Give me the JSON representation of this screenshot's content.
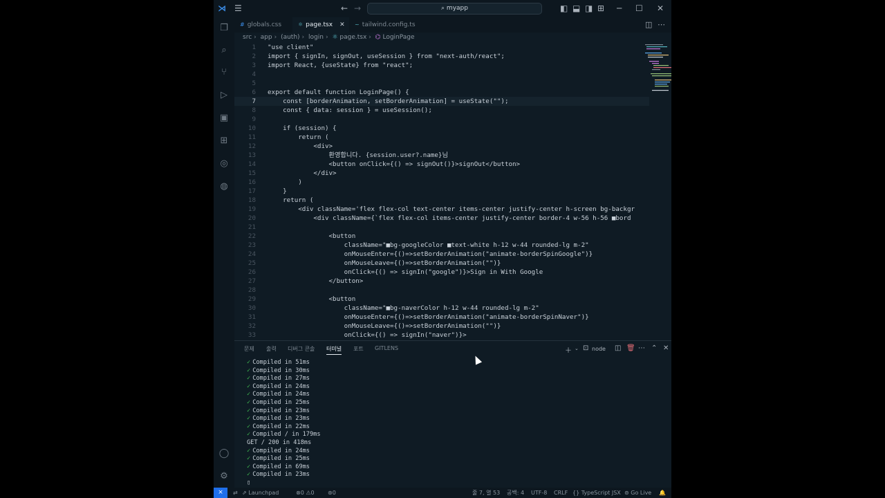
{
  "titlebar": {
    "search_text": "myapp"
  },
  "tabs": [
    {
      "label": "globals.css",
      "icon": "#"
    },
    {
      "label": "page.tsx",
      "icon": "⚛"
    },
    {
      "label": "tailwind.config.ts",
      "icon": "~"
    }
  ],
  "breadcrumb": [
    "src",
    "app",
    "(auth)",
    "login",
    "page.tsx",
    "LoginPage"
  ],
  "editor": {
    "lines": [
      {
        "n": "1",
        "t": "\"use client\""
      },
      {
        "n": "2",
        "t": "import { signIn, signOut, useSession } from \"next-auth/react\";"
      },
      {
        "n": "3",
        "t": "import React, {useState} from \"react\";"
      },
      {
        "n": "4",
        "t": ""
      },
      {
        "n": "5",
        "t": ""
      },
      {
        "n": "6",
        "t": "export default function LoginPage() {"
      },
      {
        "n": "7",
        "t": "    const [borderAnimation, setBorderAnimation] = useState(\"\");"
      },
      {
        "n": "8",
        "t": "    const { data: session } = useSession();"
      },
      {
        "n": "9",
        "t": ""
      },
      {
        "n": "10",
        "t": "    if (session) {"
      },
      {
        "n": "11",
        "t": "        return ("
      },
      {
        "n": "12",
        "t": "            <div>"
      },
      {
        "n": "13",
        "t": "                환영합니다. {session.user?.name}님"
      },
      {
        "n": "14",
        "t": "                <button onClick={() => signOut()}>signOut</button>"
      },
      {
        "n": "15",
        "t": "            </div>"
      },
      {
        "n": "16",
        "t": "        )"
      },
      {
        "n": "17",
        "t": "    }"
      },
      {
        "n": "18",
        "t": "    return ("
      },
      {
        "n": "19",
        "t": "        <div className='flex flex-col text-center items-center justify-center h-screen bg-backgr"
      },
      {
        "n": "20",
        "t": "            <div className={`flex flex-col items-center justify-center border-4 w-56 h-56 ■bord"
      },
      {
        "n": "21",
        "t": ""
      },
      {
        "n": "22",
        "t": "                <button"
      },
      {
        "n": "23",
        "t": "                    className=\"■bg-googleColor ■text-white h-12 w-44 rounded-lg m-2\""
      },
      {
        "n": "24",
        "t": "                    onMouseEnter={()=>setBorderAnimation(\"animate-borderSpinGoogle\")}"
      },
      {
        "n": "25",
        "t": "                    onMouseLeave={()=>setBorderAnimation(\"\")}"
      },
      {
        "n": "26",
        "t": "                    onClick={() => signIn(\"google\")}>Sign in With Google"
      },
      {
        "n": "27",
        "t": "                </button>"
      },
      {
        "n": "28",
        "t": ""
      },
      {
        "n": "29",
        "t": "                <button"
      },
      {
        "n": "30",
        "t": "                    className=\"■bg-naverColor h-12 w-44 rounded-lg m-2\""
      },
      {
        "n": "31",
        "t": "                    onMouseEnter={()=>setBorderAnimation(\"animate-borderSpinNaver\")}"
      },
      {
        "n": "32",
        "t": "                    onMouseLeave={()=>setBorderAnimation(\"\")}"
      },
      {
        "n": "33",
        "t": "                    onClick={() => signIn(\"naver\")}>"
      }
    ]
  },
  "panel": {
    "tabs": [
      "문제",
      "출력",
      "디버그 콘솔",
      "터미널",
      "포트",
      "GITLENS"
    ],
    "terminal_name": "node",
    "terminal": [
      {
        "ok": true,
        "t": "Compiled in 51ms"
      },
      {
        "ok": true,
        "t": "Compiled in 30ms"
      },
      {
        "ok": true,
        "t": "Compiled in 27ms"
      },
      {
        "ok": true,
        "t": "Compiled in 24ms"
      },
      {
        "ok": true,
        "t": "Compiled in 24ms"
      },
      {
        "ok": true,
        "t": "Compiled in 25ms"
      },
      {
        "ok": true,
        "t": "Compiled in 23ms"
      },
      {
        "ok": true,
        "t": "Compiled in 23ms"
      },
      {
        "ok": true,
        "t": "Compiled in 22ms"
      },
      {
        "ok": true,
        "t": "Compiled / in 179ms"
      },
      {
        "ok": false,
        "t": "GET / 200 in 418ms"
      },
      {
        "ok": true,
        "t": "Compiled in 24ms"
      },
      {
        "ok": true,
        "t": "Compiled in 25ms"
      },
      {
        "ok": true,
        "t": "Compiled in 69ms"
      },
      {
        "ok": true,
        "t": "Compiled in 23ms"
      }
    ]
  },
  "status": {
    "launchpad": "Launchpad",
    "errors": "0",
    "warnings": "0",
    "ports": "0",
    "position": "줄 7, 열 53",
    "spaces": "공백: 4",
    "encoding": "UTF-8",
    "eol": "CRLF",
    "language": "TypeScript JSX",
    "golive": "Go Live"
  },
  "colors": {
    "accent": "#1f6feb",
    "background": "#0f1b24",
    "check": "#3fb950"
  }
}
